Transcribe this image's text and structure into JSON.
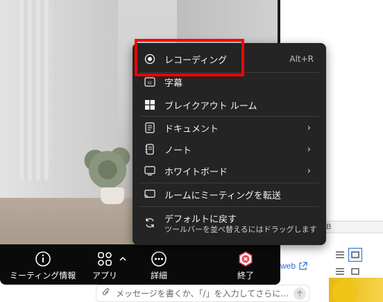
{
  "menu": {
    "items": [
      {
        "label": "レコーディング",
        "shortcut": "Alt+R",
        "icon": "record-icon"
      },
      {
        "label": "字幕",
        "icon": "captions-icon"
      },
      {
        "label": "ブレイクアウト ルーム",
        "icon": "breakout-rooms-icon"
      },
      {
        "label": "ドキュメント",
        "icon": "document-icon",
        "has_submenu": true
      },
      {
        "label": "ノート",
        "icon": "notes-icon",
        "has_submenu": true
      },
      {
        "label": "ホワイトボード",
        "icon": "whiteboard-icon",
        "has_submenu": true
      },
      {
        "label": "ルームにミーティングを転送",
        "icon": "transfer-to-room-icon"
      },
      {
        "label": "デフォルトに戻す",
        "sublabel": "ツールバーを並べ替えるにはドラッグします",
        "icon": "reset-icon"
      }
    ],
    "submenu_chevron": "›"
  },
  "toolbar": {
    "items": [
      {
        "label": "ミーティング情報",
        "icon": "info-icon"
      },
      {
        "label": "アプリ",
        "icon": "apps-icon"
      },
      {
        "label": "詳細",
        "icon": "more-icon"
      },
      {
        "label": "終了",
        "icon": "end-call-icon"
      }
    ],
    "apps_caret": "^"
  },
  "right_panel": {
    "tab_label": "B",
    "web_link_label": "web"
  },
  "chat": {
    "placeholder": "メッセージを書くか、「/」を入力してさらに..."
  },
  "colors": {
    "menu_bg": "#242424",
    "toolbar_bg": "#0a0a0a",
    "end_call": "#e74856",
    "highlight": "#ff0000",
    "accent": "#2a6fd6"
  }
}
